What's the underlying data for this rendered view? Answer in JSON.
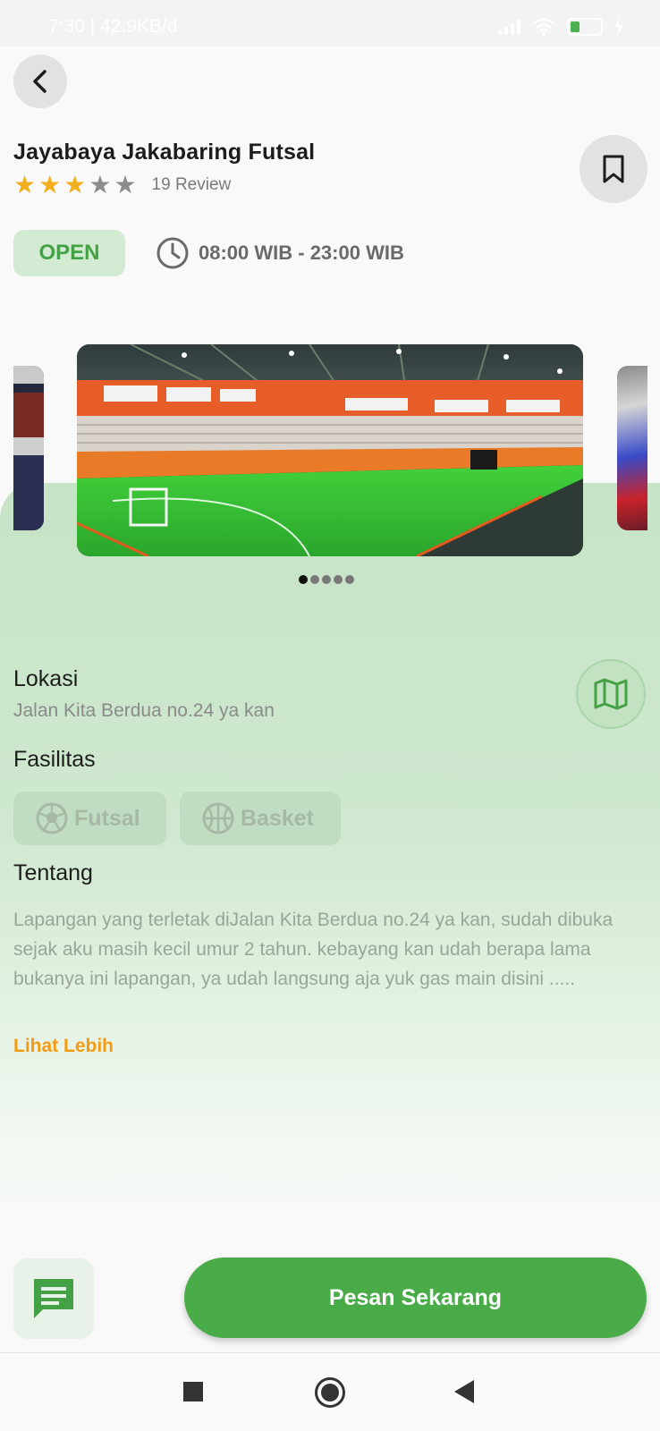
{
  "status_bar": {
    "left_text": "7:30 | 42.9KB/d",
    "battery_level": 0.25
  },
  "venue": {
    "name": "Jayabaya Jakabaring Futsal",
    "rating": 3,
    "rating_max": 5,
    "review_text": "19 Review",
    "status": "OPEN",
    "hours": "08:00 WIB - 23:00 WIB"
  },
  "carousel": {
    "image_count": 5,
    "active_index": 0
  },
  "location": {
    "heading": "Lokasi",
    "address": "Jalan Kita Berdua no.24 ya kan"
  },
  "facilities": {
    "heading": "Fasilitas",
    "items": [
      {
        "label": "Futsal",
        "icon": "soccer-ball-icon"
      },
      {
        "label": "Basket",
        "icon": "basketball-icon"
      }
    ]
  },
  "about": {
    "heading": "Tentang",
    "text": "Lapangan yang terletak diJalan Kita Berdua no.24 ya kan, sudah dibuka sejak aku masih kecil umur 2 tahun. kebayang kan udah berapa lama bukanya ini lapangan, ya udah langsung aja yuk gas main disini .....",
    "see_more": "Lihat Lebih"
  },
  "actions": {
    "order_label": "Pesan Sekarang"
  },
  "colors": {
    "primary": "#49ac49",
    "accent": "#f39c12",
    "star": "#f2b01e"
  }
}
